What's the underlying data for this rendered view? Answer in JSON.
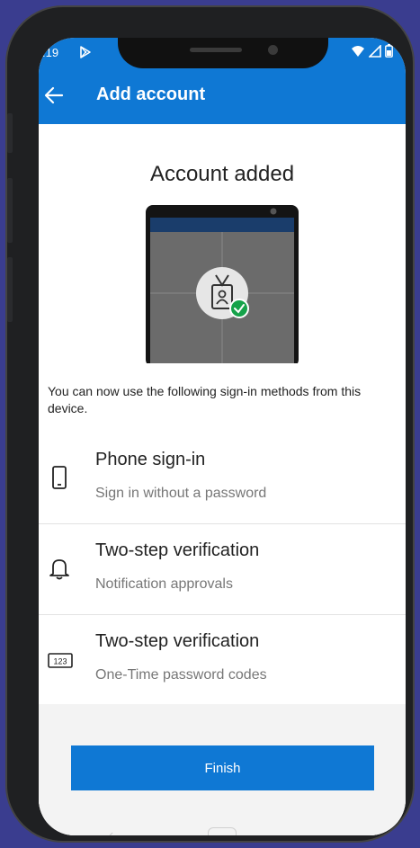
{
  "status_bar": {
    "time": ":19"
  },
  "app_bar": {
    "title": "Add account"
  },
  "main": {
    "title": "Account added",
    "description": "You can now use the following sign-in methods from this device."
  },
  "methods": [
    {
      "title": "Phone sign-in",
      "subtitle": "Sign in without a password",
      "icon": "phone-icon"
    },
    {
      "title": "Two-step verification",
      "subtitle": "Notification approvals",
      "icon": "bell-icon"
    },
    {
      "title": "Two-step verification",
      "subtitle": "One-Time password codes",
      "icon": "code-123-icon",
      "icon_text": "123"
    }
  ],
  "actions": {
    "finish_label": "Finish"
  },
  "colors": {
    "accent": "#0f78d4",
    "success": "#15a34a",
    "background": "#3a3d8f"
  }
}
